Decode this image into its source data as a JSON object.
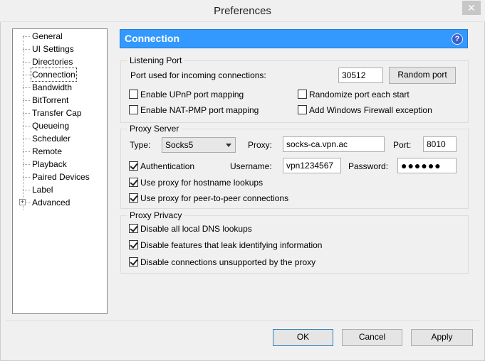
{
  "window": {
    "title": "Preferences",
    "close_symbol": "✕"
  },
  "tree": {
    "items": [
      {
        "label": "General"
      },
      {
        "label": "UI Settings"
      },
      {
        "label": "Directories"
      },
      {
        "label": "Connection",
        "selected": true
      },
      {
        "label": "Bandwidth"
      },
      {
        "label": "BitTorrent"
      },
      {
        "label": "Transfer Cap"
      },
      {
        "label": "Queueing"
      },
      {
        "label": "Scheduler"
      },
      {
        "label": "Remote"
      },
      {
        "label": "Playback"
      },
      {
        "label": "Paired Devices"
      },
      {
        "label": "Label"
      },
      {
        "label": "Advanced",
        "expandable": true
      }
    ],
    "expander_symbol": "+"
  },
  "header": {
    "title": "Connection",
    "help_symbol": "?"
  },
  "listening_port": {
    "group_title": "Listening Port",
    "port_label": "Port used for incoming connections:",
    "port_value": "30512",
    "random_port_button": "Random port",
    "upnp_label": "Enable UPnP port mapping",
    "upnp_checked": false,
    "natpmp_label": "Enable NAT-PMP port mapping",
    "natpmp_checked": false,
    "randomize_label": "Randomize port each start",
    "randomize_checked": false,
    "firewall_label": "Add Windows Firewall exception",
    "firewall_checked": false
  },
  "proxy_server": {
    "group_title": "Proxy Server",
    "type_label": "Type:",
    "type_value": "Socks5",
    "proxy_label": "Proxy:",
    "proxy_value": "socks-ca.vpn.ac",
    "port_label": "Port:",
    "port_value": "8010",
    "auth_label": "Authentication",
    "auth_checked": true,
    "username_label": "Username:",
    "username_value": "vpn1234567",
    "password_label": "Password:",
    "password_value": "●●●●●●",
    "hostname_label": "Use proxy for hostname lookups",
    "hostname_checked": true,
    "p2p_label": "Use proxy for peer-to-peer connections",
    "p2p_checked": true
  },
  "proxy_privacy": {
    "group_title": "Proxy Privacy",
    "dns_label": "Disable all local DNS lookups",
    "dns_checked": true,
    "leak_label": "Disable features that leak identifying information",
    "leak_checked": true,
    "unsupported_label": "Disable connections unsupported by the proxy",
    "unsupported_checked": true
  },
  "footer": {
    "ok_label": "OK",
    "cancel_label": "Cancel",
    "apply_label": "Apply"
  }
}
